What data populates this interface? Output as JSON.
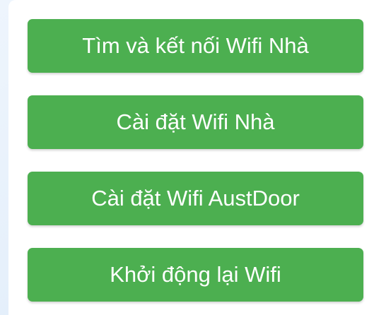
{
  "theme": {
    "button_color": "#4caf50",
    "text_color": "#ffffff"
  },
  "menu": {
    "buttons": [
      {
        "label": "Tìm và kết nối Wifi Nhà"
      },
      {
        "label": "Cài đặt Wifi Nhà"
      },
      {
        "label": "Cài đặt Wifi AustDoor"
      },
      {
        "label": "Khởi động lại Wifi"
      }
    ]
  }
}
